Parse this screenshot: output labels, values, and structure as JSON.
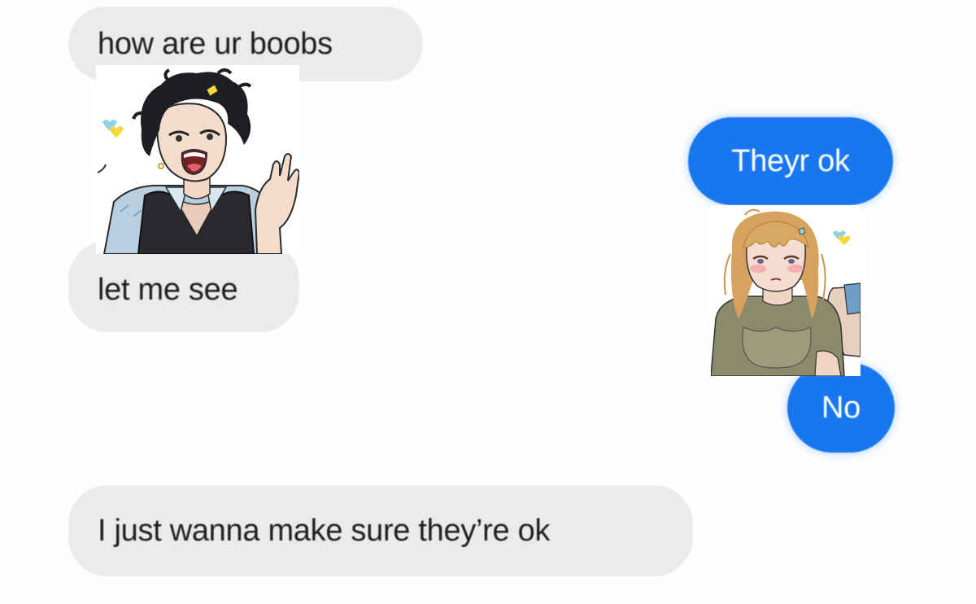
{
  "messages": {
    "incoming_1": "how are ur boobs",
    "incoming_2": "let me see",
    "incoming_3": "I just wanna make sure they’re ok",
    "outgoing_1": "Theyr ok",
    "outgoing_2": "No"
  },
  "colors": {
    "incoming_bubble": "#ebebeb",
    "outgoing_bubble": "#1877f0",
    "incoming_text": "#1f1f1f",
    "outgoing_text": "#ffffff"
  },
  "stickers": {
    "left": "dark-haired-character-yelling-sticker",
    "right": "blonde-character-blushing-sticker"
  }
}
